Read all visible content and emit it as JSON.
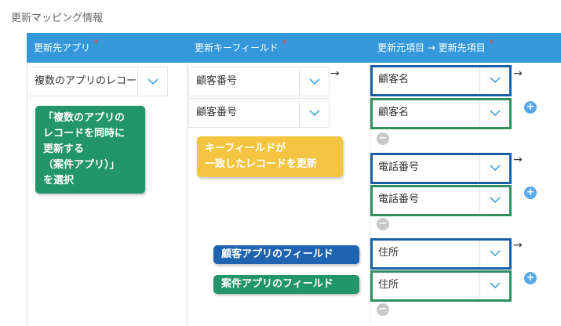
{
  "section_title": "更新マッピング情報",
  "header": {
    "col1": "更新先アプリ",
    "col2": "更新キーフィールド",
    "col3": "更新元項目 → 更新先項目",
    "required_mark": "*"
  },
  "app_select": {
    "value": "複数のアプリのレコー"
  },
  "key_fields": [
    {
      "value": "顧客番号"
    },
    {
      "value": "顧客番号"
    }
  ],
  "mapping_rows": [
    {
      "source": "顧客名",
      "target": "顧客名"
    },
    {
      "source": "電話番号",
      "target": "電話番号"
    },
    {
      "source": "住所",
      "target": "住所"
    }
  ],
  "arrow_symbol": "→",
  "plus_symbol": "+",
  "minus_symbol": "−",
  "callouts": {
    "select_app": "「複数のアプリの\nレコードを同時に\n更新する\n（案件アプリ）」\nを選択",
    "key_field": "キーフィールドが\n一致したレコードを更新",
    "customer_app": "顧客アプリのフィールド",
    "project_app": "案件アプリのフィールド"
  },
  "colors": {
    "header": "#3498db",
    "customer_border": "#1a5fa6",
    "project_border": "#2f8f5f",
    "callout_green": "#23956a",
    "callout_yellow": "#f5c542",
    "callout_blue": "#1e64b0"
  }
}
